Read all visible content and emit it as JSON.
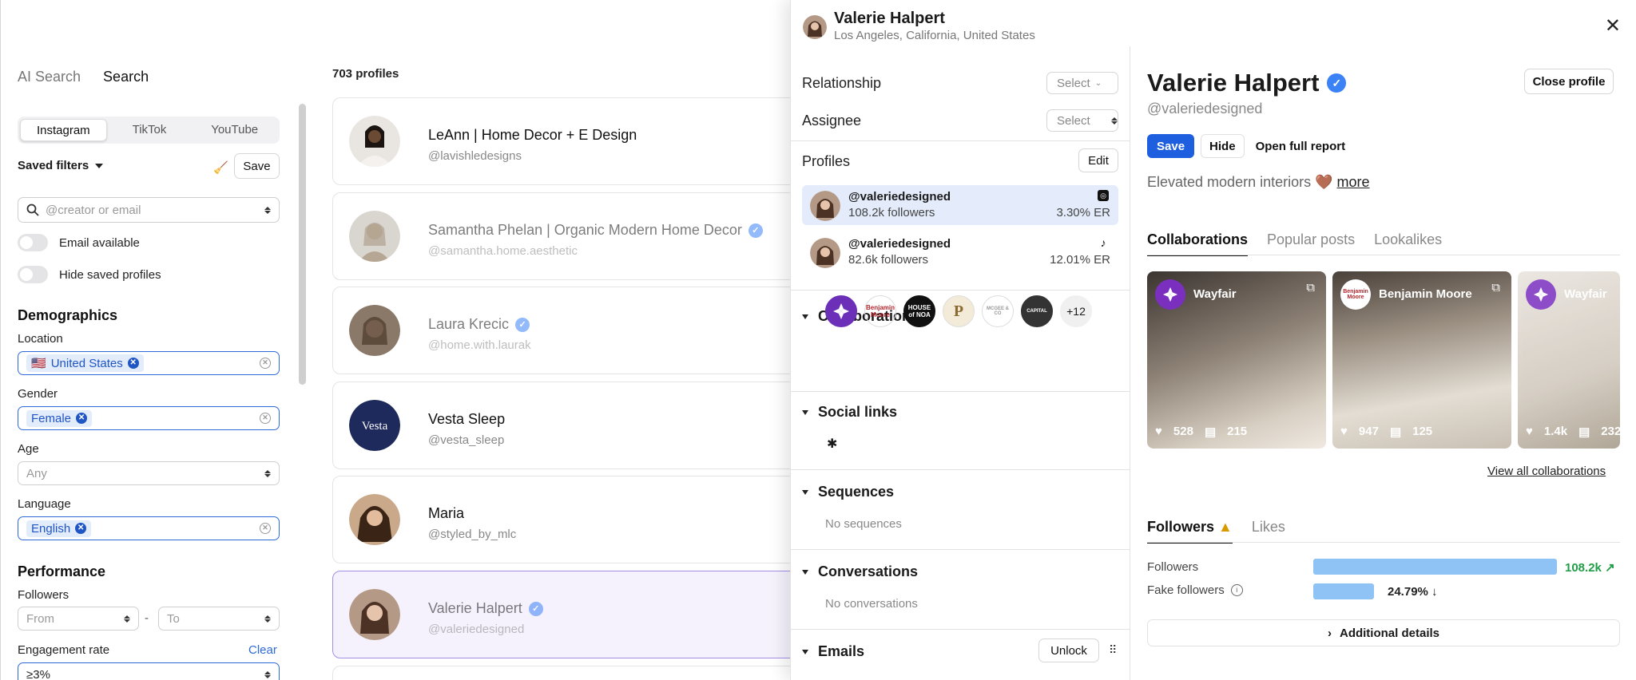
{
  "sidebar": {
    "search_tabs": [
      "AI Search",
      "Search"
    ],
    "platforms": [
      "Instagram",
      "TikTok",
      "YouTube"
    ],
    "saved_filters_label": "Saved filters",
    "save_label": "Save",
    "creator_placeholder": "@creator or email",
    "toggles": [
      "Email available",
      "Hide saved profiles"
    ],
    "demographics_title": "Demographics",
    "location_label": "Location",
    "location_value": "United States",
    "location_flag": "🇺🇸",
    "gender_label": "Gender",
    "gender_value": "Female",
    "age_label": "Age",
    "age_value": "Any",
    "language_label": "Language",
    "language_value": "English",
    "performance_title": "Performance",
    "followers_label": "Followers",
    "followers_from": "From",
    "followers_to": "To",
    "range_sep": "-",
    "er_label": "Engagement rate",
    "er_clear": "Clear",
    "er_value": "≥3%"
  },
  "list": {
    "count": "703 profiles",
    "profiles": [
      {
        "name": "LeAnn | Home Decor + E Design",
        "handle": "@lavishledesigns",
        "verified": false
      },
      {
        "name": "Samantha Phelan | Organic Modern Home Decor",
        "handle": "@samantha.home.aesthetic",
        "verified": true
      },
      {
        "name": "Laura Krecic",
        "handle": "@home.with.laurak",
        "verified": true
      },
      {
        "name": "Vesta Sleep",
        "handle": "@vesta_sleep",
        "verified": false,
        "logo": "Vesta"
      },
      {
        "name": "Maria",
        "handle": "@styled_by_mlc",
        "verified": false
      },
      {
        "name": "Valerie Halpert",
        "handle": "@valeriedesigned",
        "verified": true
      }
    ]
  },
  "drawer": {
    "name": "Valerie Halpert",
    "location": "Los Angeles, California, United States",
    "relationship_label": "Relationship",
    "assignee_label": "Assignee",
    "select_label": "Select",
    "profiles_label": "Profiles",
    "edit_label": "Edit",
    "accounts": [
      {
        "handle": "@valeriedesigned",
        "followers": "108.2k followers",
        "er": "3.30% ER",
        "platform_icon": "instagram-icon"
      },
      {
        "handle": "@valeriedesigned",
        "followers": "82.6k followers",
        "er": "12.01% ER",
        "platform_icon": "tiktok-icon"
      }
    ],
    "collaborations_label": "Collaborations",
    "brand_logos": [
      "Benjamin Moore",
      "HOUSE of NOA",
      "P",
      "MCGEE & CO",
      "CAPITAL"
    ],
    "more_count": "+12",
    "social_links_label": "Social links",
    "sequences_label": "Sequences",
    "no_sequences": "No sequences",
    "conversations_label": "Conversations",
    "no_conversations": "No conversations",
    "emails_label": "Emails",
    "unlock_label": "Unlock",
    "profile": {
      "name": "Valerie Halpert",
      "handle": "@valeriedesigned",
      "close_label": "Close profile",
      "save_label": "Save",
      "hide_label": "Hide",
      "report_label": "Open full report",
      "bio": "Elevated modern interiors 🤎",
      "more_label": "more",
      "tabs": [
        "Collaborations",
        "Popular posts",
        "Lookalikes"
      ],
      "collabs": [
        {
          "brand": "Wayfair",
          "likes": "528",
          "comments": "215"
        },
        {
          "brand": "Benjamin Moore",
          "likes": "947",
          "comments": "125"
        },
        {
          "brand": "Wayfair",
          "likes": "1.4k",
          "comments": "232"
        }
      ],
      "view_all": "View all collaborations",
      "audience_tabs": [
        "Followers",
        "Likes"
      ],
      "followers_label": "Followers",
      "followers_value": "108.2k",
      "fake_label": "Fake followers",
      "fake_value": "24.79%",
      "additional_details": "Additional details"
    }
  }
}
